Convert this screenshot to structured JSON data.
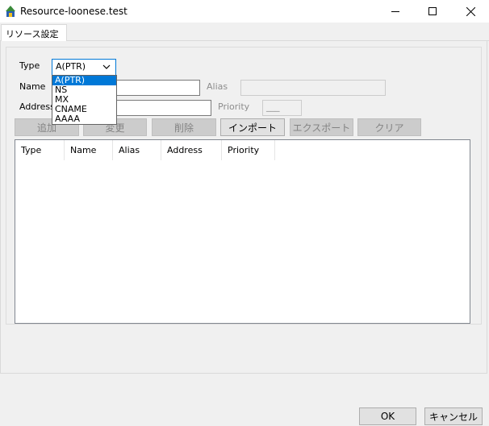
{
  "window": {
    "title": "Resource-loonese.test",
    "icon": "app-icon",
    "controls": {
      "minimize": "—",
      "maximize": "☐",
      "close": "✕"
    }
  },
  "tabs": [
    {
      "label": "リソース設定",
      "active": true
    }
  ],
  "form": {
    "type_label": "Type",
    "type_value": "A(PTR)",
    "type_options": [
      "A(PTR)",
      "NS",
      "MX",
      "CNAME",
      "AAAA"
    ],
    "name_label": "Name",
    "name_value": "",
    "alias_label": "Alias",
    "alias_value": "",
    "address_label": "Address",
    "address_value": "",
    "priority_label": "Priority",
    "priority_value": "___"
  },
  "actions": {
    "add": "追加",
    "change": "変更",
    "delete": "削除",
    "import": "インポート",
    "export": "エクスポート",
    "clear": "クリア"
  },
  "list": {
    "columns": [
      "Type",
      "Name",
      "Alias",
      "Address",
      "Priority"
    ],
    "rows": []
  },
  "footer": {
    "ok": "OK",
    "cancel": "キャンセル"
  },
  "colors": {
    "accent": "#0078d7",
    "selected_bg": "#0078d7",
    "disabled_text": "#838383"
  }
}
